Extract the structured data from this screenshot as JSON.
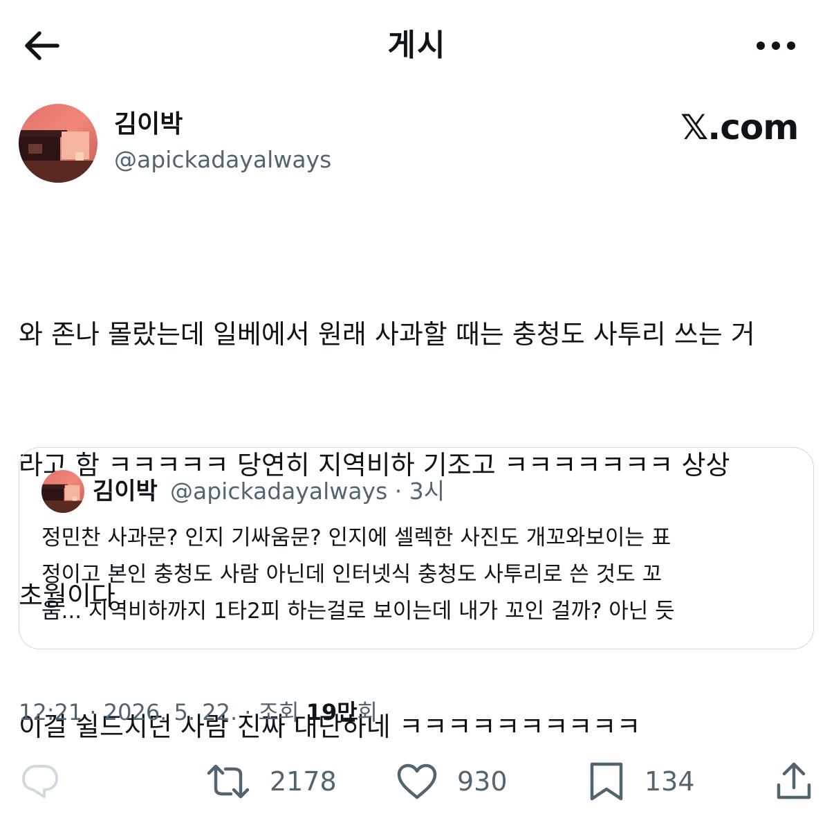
{
  "header": {
    "title": "게시"
  },
  "author": {
    "name": "김이박",
    "handle": "@apickadayalways"
  },
  "watermark": "𝕏.com",
  "tweet": {
    "lines": [
      "와 존나 몰랐는데 일베에서 원래 사과할 때는 충청도 사투리 쓰는 거",
      "라고 함 ㅋㅋㅋㅋㅋ 당연히 지역비하 기조고 ㅋㅋㅋㅋㅋㅋㅋ 상상",
      "초월이다",
      "이걸 쉴드치던 사람 진짜 대단하네 ㅋㅋㅋㅋㅋㅋㅋㅋㅋㅋ"
    ]
  },
  "quote": {
    "name": "김이박",
    "handle_time": "@apickadayalways · 3시",
    "lines": [
      "정민찬 사과문? 인지 기싸움문? 인지에 셀렉한 사진도 개꼬와보이는 표",
      "정이고 본인 충청도 사람 아닌데 인터넷식 충청도 사투리로 쓴 것도 꼬",
      "움... 지역비하까지 1타2피 하는걸로 보이는데 내가 꼬인 걸까? 아닌 듯"
    ]
  },
  "meta": {
    "time_date": "12:21 · 2026. 5. 22. · 조회 ",
    "views": "19만",
    "views_suffix": "회"
  },
  "actions": {
    "reply_icon": "reply-icon",
    "retweet_count": "2178",
    "like_count": "930",
    "bookmark_count": "134"
  },
  "colors": {
    "text_primary": "#0f1419",
    "text_secondary": "#536471",
    "border": "#cfd9de",
    "icon_reply": "#cfd9de"
  }
}
